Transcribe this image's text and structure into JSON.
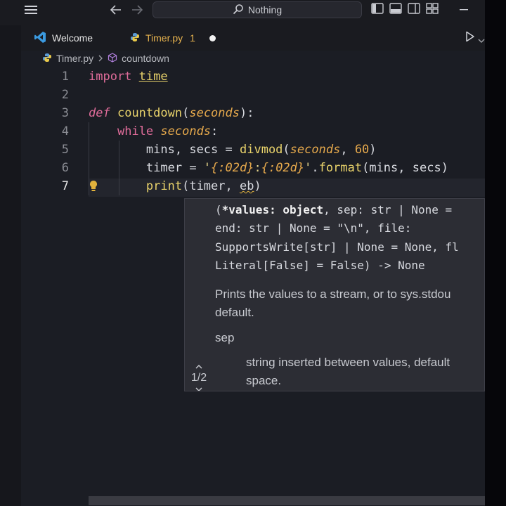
{
  "titlebar": {
    "search_text": "Nothing"
  },
  "tabs": [
    {
      "label": "Welcome"
    },
    {
      "label": "Timer.py",
      "badge": "1"
    }
  ],
  "breadcrumb": {
    "file": "Timer.py",
    "symbol": "countdown"
  },
  "editor": {
    "line_numbers": [
      "1",
      "2",
      "3",
      "4",
      "5",
      "6",
      "7"
    ],
    "tokens": {
      "import": "import",
      "time": "time",
      "def": "def",
      "countdown": "countdown",
      "seconds": "seconds",
      "while": "while",
      "mins": "mins",
      "secs": "secs",
      "divmod": "divmod",
      "sixty": "60",
      "timer": "timer",
      "fmt1": "{:02d}",
      "fmt2": "{:02d}",
      "format": "format",
      "print": "print",
      "typed": "eb"
    }
  },
  "hover": {
    "signature_1_pre": "(",
    "signature_1_bold": "*values: object",
    "signature_1_post": ", sep: str | None = ",
    "signature_2": "end: str | None = \"\\n\", file: ",
    "signature_3": "SupportsWrite[str] | None = None, fl",
    "signature_4": "Literal[False] = False) -> None",
    "doc_1": "Prints the values to a stream, or to sys.stdou",
    "doc_2": "default.",
    "param_name": "sep",
    "param_doc_1": "string inserted between values, default",
    "param_doc_2": "space.",
    "pager": "1/2"
  },
  "colors": {
    "background": "#1b1d24",
    "keyword": "#e06c9a",
    "function": "#e9d36b",
    "parameter": "#e6a94c",
    "modified_tab": "#e6b24e"
  }
}
